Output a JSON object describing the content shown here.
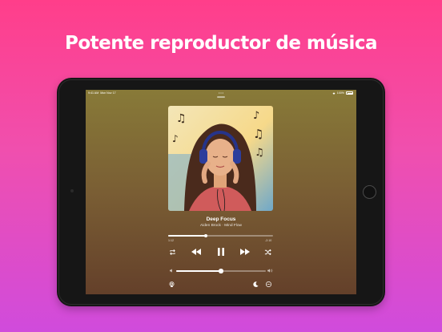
{
  "headline": "Potente reproductor de música",
  "status": {
    "time": "9:41 AM",
    "date": "Mon Nov 17",
    "center": "• • •",
    "battery": "100%"
  },
  "track": {
    "title": "Deep Focus",
    "subtitle": "Aiden Brock · Mind Flow",
    "elapsed": "1:12",
    "remaining": "-2:10",
    "progress": 0.36
  },
  "volume": {
    "level": 0.5
  },
  "icons": {
    "repeat": "repeat-icon",
    "rewind": "rewind-icon",
    "pause": "pause-icon",
    "forward": "forward-icon",
    "shuffle": "shuffle-icon",
    "speaker_low": "speaker-low-icon",
    "speaker_high": "speaker-high-icon",
    "airplay": "airplay-icon",
    "sleep_timer": "moon-icon",
    "more": "more-icon"
  },
  "colors": {
    "bg_top": "#ff3e8a",
    "bg_bottom": "#d04bdc",
    "screen_top": "#887a38",
    "screen_bottom": "#64402a"
  }
}
